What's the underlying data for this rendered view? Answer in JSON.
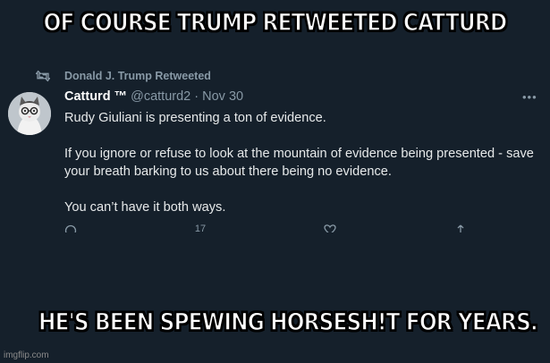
{
  "meme": {
    "top_caption": "OF COURSE TRUMP RETWEETED CATTURD",
    "bottom_caption": "HE'S BEEN SPEWING HORSESH!T FOR YEARS."
  },
  "tweet": {
    "retweet_label": "Donald J. Trump Retweeted",
    "author_name": "Catturd ™",
    "handle": "@catturd2",
    "separator": " · ",
    "date": "Nov 30",
    "more_label": "•••",
    "paragraphs": [
      "Rudy Giuliani is presenting a ton of evidence.",
      "If you ignore or refuse to look at the mountain of evidence being presented - save your breath barking to us about there being no evidence.",
      "You can’t have it both ways."
    ],
    "actions": {
      "reply_icon": "reply-icon",
      "retweet_count": "17",
      "like_icon": "heart-icon",
      "share_icon": "share-icon"
    }
  },
  "credit": "imgflip.com",
  "colors": {
    "background": "#15202b",
    "muted": "#8899a6",
    "text": "#e6e9ea"
  }
}
